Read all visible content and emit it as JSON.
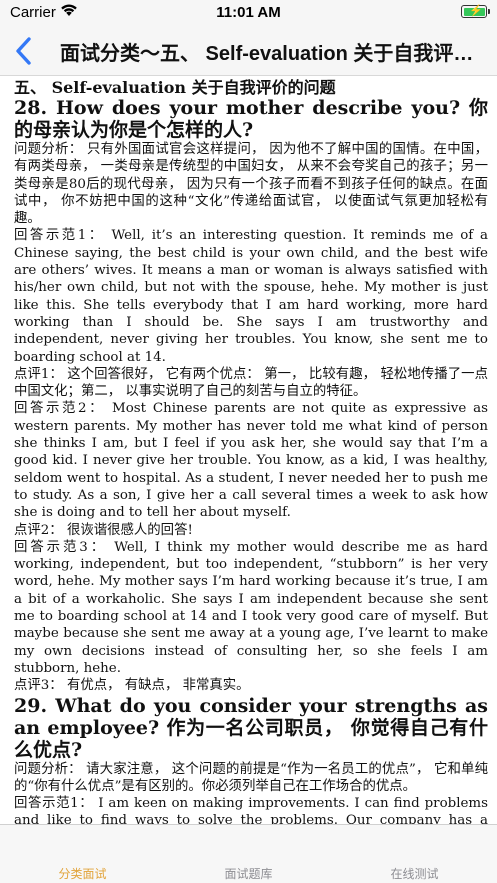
{
  "status_bar": {
    "carrier": "Carrier",
    "time": "11:01 AM"
  },
  "nav": {
    "title": "面试分类～五、 Self-evaluation 关于自我评价的问题"
  },
  "content": {
    "section_title": "五、 Self-evaluation 关于自我评价的问题",
    "q28_title": "28. How does your mother describe you? 你的母亲认为你是个怎样的人?",
    "q28_analysis": "问题分析： 只有外国面试官会这样提问， 因为他不了解中国的国情。在中国， 有两类母亲， 一类母亲是传统型的中国妇女， 从来不会夸奖自己的孩子；另一类母亲是80后的现代母亲， 因为只有一个孩子而看不到孩子任何的缺点。在面试中， 你不妨把中国的这种“文化”传递给面试官， 以使面试气氛更加轻松有趣。",
    "q28_answer1": "回答示范1： Well, it’s an interesting question. It reminds me of a Chinese saying, the best child is your own child, and the best wife are others’ wives. It means a man or woman is always satisfied with his/her own child, but not with the spouse, hehe. My mother is just like this. She tells everybody that I am hard working, more hard working than I should be. She says I am trustworthy and independent, never giving her troubles. You know, she sent me to boarding school at 14.",
    "q28_comment1": "点评1： 这个回答很好， 它有两个优点： 第一， 比较有趣， 轻松地传播了一点中国文化；第二， 以事实说明了自己的刻苦与自立的特征。",
    "q28_answer2": "回答示范2： Most Chinese parents are not quite as expressive as western parents. My mother has never told me what kind of person she thinks I am, but I feel if you ask her, she would say that I’m a good kid. I never give her trouble. You know, as a kid, I was healthy, seldom went to hospital. As a student, I never needed her to push me to study. As a son, I give her a call several times a week to ask how she is doing and to tell her about myself.",
    "q28_comment2": "点评2： 很诙谐很感人的回答!",
    "q28_answer3": "回答示范3： Well, I think my mother would describe me as hard working, independent, but too independent, “stubborn” is her very word, hehe. My mother says I’m hard working because it’s true, I am a bit of a workaholic. She says I am independent because she sent me to boarding school at 14 and I took very good care of myself. But maybe because she sent me away at a young age, I’ve learnt to make my own decisions instead of consulting her, so she feels I am stubborn, hehe.",
    "q28_comment3": "点评3： 有优点， 有缺点， 非常真实。",
    "q29_title": "29. What do you consider your strengths as an employee? 作为一名公司职员， 你觉得自己有什么优点?",
    "q29_analysis": "问题分析： 请大家注意， 这个问题的前提是“作为一名员工的优点”， 它和单纯的“你有什么优点”是有区别的。你必须列举自己在工作场合的优点。",
    "q29_answer1": "回答示范1： I am keen on making improvements. I can find problems and like to find ways to solve the problems. Our company has a Suggestion Scheme, that is, every employee is encouraged to offer suggestions on"
  },
  "tabs": [
    {
      "label": "分类面试",
      "active": true
    },
    {
      "label": "面试题库",
      "active": false
    },
    {
      "label": "在线测试",
      "active": false
    }
  ],
  "colors": {
    "accent": "#3478f6",
    "tab_active": "#e2a43b",
    "tab_inactive": "#8e8e93",
    "battery": "#35c759"
  }
}
